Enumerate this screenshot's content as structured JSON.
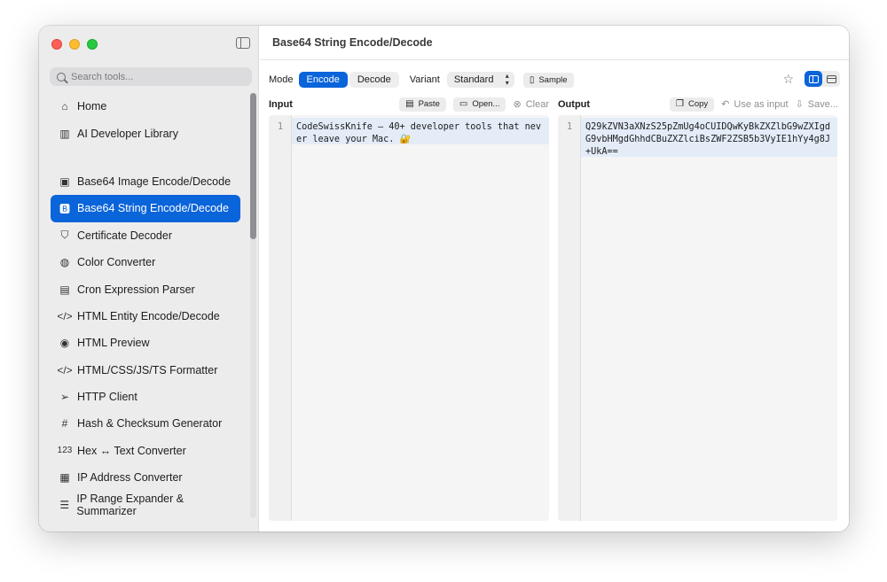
{
  "window": {
    "title": "Base64 String Encode/Decode"
  },
  "sidebar": {
    "search_placeholder": "Search tools...",
    "top_items": [
      {
        "label": "Home",
        "icon": "house-icon"
      },
      {
        "label": "AI Developer Library",
        "icon": "books-icon"
      }
    ],
    "items": [
      {
        "label": "Base64 Image Encode/Decode",
        "icon": "photo-icon"
      },
      {
        "label": "Base64 String Encode/Decode",
        "icon": "b-square-icon",
        "active": true
      },
      {
        "label": "Certificate Decoder",
        "icon": "shield-check-icon"
      },
      {
        "label": "Color Converter",
        "icon": "palette-icon"
      },
      {
        "label": "Cron Expression Parser",
        "icon": "calendar-clock-icon"
      },
      {
        "label": "HTML Entity Encode/Decode",
        "icon": "code-brackets-icon"
      },
      {
        "label": "HTML Preview",
        "icon": "eye-icon"
      },
      {
        "label": "HTML/CSS/JS/TS Formatter",
        "icon": "code-brackets-icon"
      },
      {
        "label": "HTTP Client",
        "icon": "paperplane-icon"
      },
      {
        "label": "Hash & Checksum Generator",
        "icon": "number-sign-icon"
      },
      {
        "label": "Hex ↔ Text Converter",
        "icon": "123-icon"
      },
      {
        "label": "IP Address Converter",
        "icon": "network-icon"
      },
      {
        "label": "IP Range Expander & Summarizer",
        "icon": "list-icon"
      }
    ]
  },
  "toolbar": {
    "mode_label": "Mode",
    "encode_label": "Encode",
    "decode_label": "Decode",
    "variant_label": "Variant",
    "variant_value": "Standard",
    "sample_label": "Sample"
  },
  "input": {
    "title": "Input",
    "paste_label": "Paste",
    "open_label": "Open...",
    "clear_label": "Clear",
    "line_number": "1",
    "text": "CodeSwissKnife — 40+ developer tools that never leave your Mac. 🔐"
  },
  "output": {
    "title": "Output",
    "copy_label": "Copy",
    "use_as_input_label": "Use as input",
    "save_label": "Save...",
    "line_number": "1",
    "text": "Q29kZVN3aXNzS25pZmUg4oCUIDQwKyBkZXZlbG9wZXIgdG9vbHMgdGhhdCBuZXZlciBsZWF2ZSB5b3VyIE1hYy4g8J+UkA=="
  },
  "colors": {
    "accent": "#0a64da",
    "sidebar_bg": "#ececed",
    "editor_bg": "#f5f5f5"
  }
}
